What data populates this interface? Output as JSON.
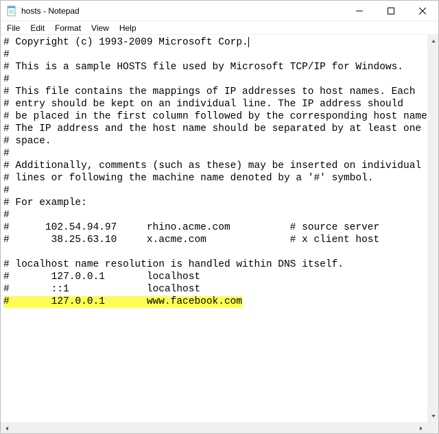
{
  "window": {
    "title": "hosts - Notepad"
  },
  "menu": {
    "file": "File",
    "edit": "Edit",
    "format": "Format",
    "view": "View",
    "help": "Help"
  },
  "content": {
    "lines": [
      "# Copyright (c) 1993-2009 Microsoft Corp.",
      "#",
      "# This is a sample HOSTS file used by Microsoft TCP/IP for Windows.",
      "#",
      "# This file contains the mappings of IP addresses to host names. Each",
      "# entry should be kept on an individual line. The IP address should",
      "# be placed in the first column followed by the corresponding host name.",
      "# The IP address and the host name should be separated by at least one",
      "# space.",
      "#",
      "# Additionally, comments (such as these) may be inserted on individual",
      "# lines or following the machine name denoted by a '#' symbol.",
      "#",
      "# For example:",
      "#",
      "#      102.54.94.97     rhino.acme.com          # source server",
      "#       38.25.63.10     x.acme.com              # x client host",
      "",
      "# localhost name resolution is handled within DNS itself.",
      "#       127.0.0.1       localhost",
      "#       ::1             localhost"
    ],
    "highlighted_line": "#       127.0.0.1       www.facebook.com",
    "caret_after_line_index": 0
  }
}
